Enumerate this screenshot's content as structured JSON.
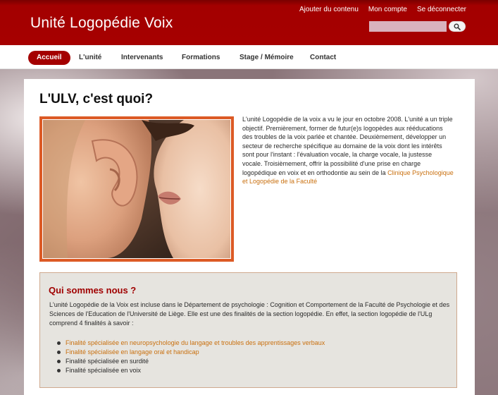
{
  "header": {
    "site_title": "Unité Logopédie Voix",
    "user_links": [
      "Ajouter du contenu",
      "Mon compte",
      "Se déconnecter"
    ],
    "search": {
      "placeholder": "",
      "value": ""
    },
    "search_icon": "search-icon",
    "color": "#a60000"
  },
  "nav": {
    "items": [
      {
        "label": "Accueil",
        "active": true
      },
      {
        "label": "L'unité"
      },
      {
        "label": "Intervenants"
      },
      {
        "label": "Formations"
      },
      {
        "label": "Stage / Mémoire"
      },
      {
        "label": "Contact"
      }
    ]
  },
  "main": {
    "title": "L'ULV, c'est quoi?",
    "intro": {
      "text": "L'unité Logopédie de la voix a vu le jour en octobre 2008. L'unité a un triple objectif. Premièrement, former de futur(e)s logopèdes aux rééducations des troubles de la voix parlée et chantée. Deuxièmement, développer un secteur de recherche spécifique au domaine de la voix dont les intérêts sont pour l'instant : l'évaluation vocale, la charge vocale, la justesse vocale. Troisièmement, offrir la possibilité d'une prise en charge logopédique en voix et en orthodontie au sein de la ",
      "link": "Clinique Psychologique et Logopédie de la Faculté"
    },
    "about": {
      "title": "Qui sommes nous ?",
      "text": "L'unité Logopédie de la Voix est incluse dans le Département de psychologie : Cognition et Comportement de la Faculté de Psychologie et des Sciences de l'Education de l'Université de Liège. Elle est une des finalités de la section logopédie. En effet, la section logopédie de l'ULg comprend 4 finalités à savoir :",
      "items": [
        {
          "label": "Finalité spécialisée en neuropsychologie du langage et troubles des apprentissages verbaux",
          "link": true
        },
        {
          "label": "Finalité spécialisée en langage oral et handicap",
          "link": true
        },
        {
          "label": "Finalité spécialisée en surdité",
          "link": false
        },
        {
          "label": "Finalité spécialisée en voix",
          "link": false
        }
      ]
    }
  },
  "colors": {
    "accent": "#a60000",
    "link": "#c9700f",
    "photo_border": "#dc5a25",
    "box_background": "#e6e4df"
  }
}
